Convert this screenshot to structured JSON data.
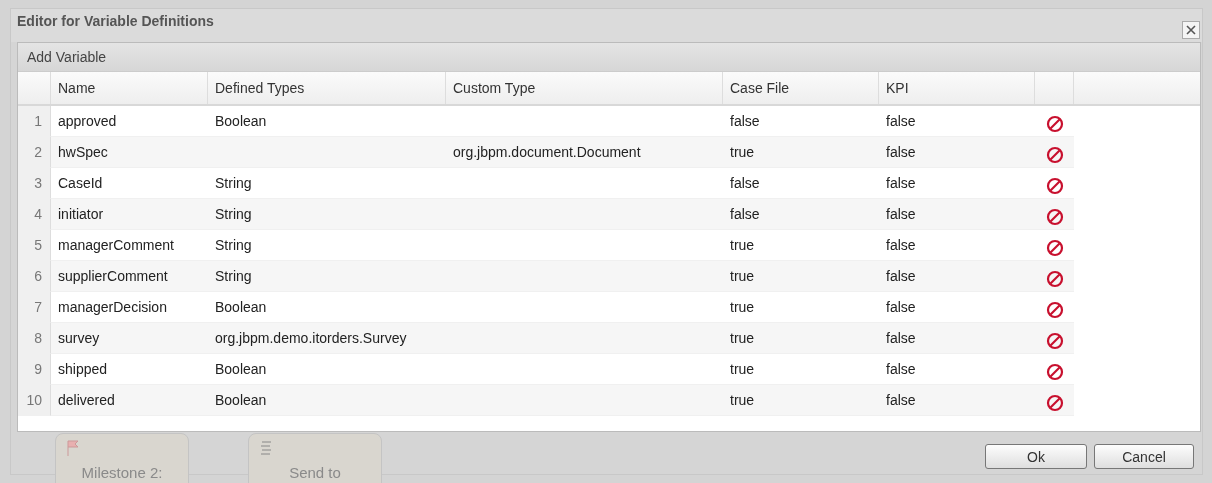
{
  "background": {
    "nodes": [
      {
        "label": "Milestone 2:",
        "kind": "milestone"
      },
      {
        "label": "Send to",
        "kind": "script"
      }
    ]
  },
  "dialog": {
    "title": "Editor for Variable Definitions",
    "toolbar": {
      "label": "Add Variable"
    },
    "table": {
      "columns": [
        "Name",
        "Defined Types",
        "Custom Type",
        "Case File",
        "KPI"
      ],
      "rows": [
        {
          "number": "1",
          "name": "approved",
          "defined_type": "Boolean",
          "custom_type": "",
          "case_file": "false",
          "kpi": "false"
        },
        {
          "number": "2",
          "name": "hwSpec",
          "defined_type": "",
          "custom_type": "org.jbpm.document.Document",
          "case_file": "true",
          "kpi": "false"
        },
        {
          "number": "3",
          "name": "CaseId",
          "defined_type": "String",
          "custom_type": "",
          "case_file": "false",
          "kpi": "false"
        },
        {
          "number": "4",
          "name": "initiator",
          "defined_type": "String",
          "custom_type": "",
          "case_file": "false",
          "kpi": "false"
        },
        {
          "number": "5",
          "name": "managerComment",
          "defined_type": "String",
          "custom_type": "",
          "case_file": "true",
          "kpi": "false"
        },
        {
          "number": "6",
          "name": "supplierComment",
          "defined_type": "String",
          "custom_type": "",
          "case_file": "true",
          "kpi": "false"
        },
        {
          "number": "7",
          "name": "managerDecision",
          "defined_type": "Boolean",
          "custom_type": "",
          "case_file": "true",
          "kpi": "false"
        },
        {
          "number": "8",
          "name": "survey",
          "defined_type": "org.jbpm.demo.itorders.Survey",
          "custom_type": "",
          "case_file": "true",
          "kpi": "false"
        },
        {
          "number": "9",
          "name": "shipped",
          "defined_type": "Boolean",
          "custom_type": "",
          "case_file": "true",
          "kpi": "false"
        },
        {
          "number": "10",
          "name": "delivered",
          "defined_type": "Boolean",
          "custom_type": "",
          "case_file": "true",
          "kpi": "false"
        }
      ]
    },
    "buttons": [
      "Ok",
      "Cancel"
    ]
  }
}
